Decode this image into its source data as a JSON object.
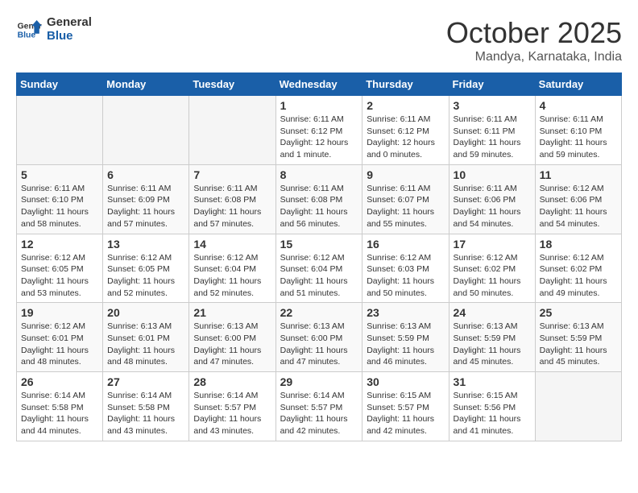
{
  "header": {
    "logo_line1": "General",
    "logo_line2": "Blue",
    "month": "October 2025",
    "location": "Mandya, Karnataka, India"
  },
  "weekdays": [
    "Sunday",
    "Monday",
    "Tuesday",
    "Wednesday",
    "Thursday",
    "Friday",
    "Saturday"
  ],
  "weeks": [
    [
      {
        "day": "",
        "info": ""
      },
      {
        "day": "",
        "info": ""
      },
      {
        "day": "",
        "info": ""
      },
      {
        "day": "1",
        "info": "Sunrise: 6:11 AM\nSunset: 6:12 PM\nDaylight: 12 hours\nand 1 minute."
      },
      {
        "day": "2",
        "info": "Sunrise: 6:11 AM\nSunset: 6:12 PM\nDaylight: 12 hours\nand 0 minutes."
      },
      {
        "day": "3",
        "info": "Sunrise: 6:11 AM\nSunset: 6:11 PM\nDaylight: 11 hours\nand 59 minutes."
      },
      {
        "day": "4",
        "info": "Sunrise: 6:11 AM\nSunset: 6:10 PM\nDaylight: 11 hours\nand 59 minutes."
      }
    ],
    [
      {
        "day": "5",
        "info": "Sunrise: 6:11 AM\nSunset: 6:10 PM\nDaylight: 11 hours\nand 58 minutes."
      },
      {
        "day": "6",
        "info": "Sunrise: 6:11 AM\nSunset: 6:09 PM\nDaylight: 11 hours\nand 57 minutes."
      },
      {
        "day": "7",
        "info": "Sunrise: 6:11 AM\nSunset: 6:08 PM\nDaylight: 11 hours\nand 57 minutes."
      },
      {
        "day": "8",
        "info": "Sunrise: 6:11 AM\nSunset: 6:08 PM\nDaylight: 11 hours\nand 56 minutes."
      },
      {
        "day": "9",
        "info": "Sunrise: 6:11 AM\nSunset: 6:07 PM\nDaylight: 11 hours\nand 55 minutes."
      },
      {
        "day": "10",
        "info": "Sunrise: 6:11 AM\nSunset: 6:06 PM\nDaylight: 11 hours\nand 54 minutes."
      },
      {
        "day": "11",
        "info": "Sunrise: 6:12 AM\nSunset: 6:06 PM\nDaylight: 11 hours\nand 54 minutes."
      }
    ],
    [
      {
        "day": "12",
        "info": "Sunrise: 6:12 AM\nSunset: 6:05 PM\nDaylight: 11 hours\nand 53 minutes."
      },
      {
        "day": "13",
        "info": "Sunrise: 6:12 AM\nSunset: 6:05 PM\nDaylight: 11 hours\nand 52 minutes."
      },
      {
        "day": "14",
        "info": "Sunrise: 6:12 AM\nSunset: 6:04 PM\nDaylight: 11 hours\nand 52 minutes."
      },
      {
        "day": "15",
        "info": "Sunrise: 6:12 AM\nSunset: 6:04 PM\nDaylight: 11 hours\nand 51 minutes."
      },
      {
        "day": "16",
        "info": "Sunrise: 6:12 AM\nSunset: 6:03 PM\nDaylight: 11 hours\nand 50 minutes."
      },
      {
        "day": "17",
        "info": "Sunrise: 6:12 AM\nSunset: 6:02 PM\nDaylight: 11 hours\nand 50 minutes."
      },
      {
        "day": "18",
        "info": "Sunrise: 6:12 AM\nSunset: 6:02 PM\nDaylight: 11 hours\nand 49 minutes."
      }
    ],
    [
      {
        "day": "19",
        "info": "Sunrise: 6:12 AM\nSunset: 6:01 PM\nDaylight: 11 hours\nand 48 minutes."
      },
      {
        "day": "20",
        "info": "Sunrise: 6:13 AM\nSunset: 6:01 PM\nDaylight: 11 hours\nand 48 minutes."
      },
      {
        "day": "21",
        "info": "Sunrise: 6:13 AM\nSunset: 6:00 PM\nDaylight: 11 hours\nand 47 minutes."
      },
      {
        "day": "22",
        "info": "Sunrise: 6:13 AM\nSunset: 6:00 PM\nDaylight: 11 hours\nand 47 minutes."
      },
      {
        "day": "23",
        "info": "Sunrise: 6:13 AM\nSunset: 5:59 PM\nDaylight: 11 hours\nand 46 minutes."
      },
      {
        "day": "24",
        "info": "Sunrise: 6:13 AM\nSunset: 5:59 PM\nDaylight: 11 hours\nand 45 minutes."
      },
      {
        "day": "25",
        "info": "Sunrise: 6:13 AM\nSunset: 5:59 PM\nDaylight: 11 hours\nand 45 minutes."
      }
    ],
    [
      {
        "day": "26",
        "info": "Sunrise: 6:14 AM\nSunset: 5:58 PM\nDaylight: 11 hours\nand 44 minutes."
      },
      {
        "day": "27",
        "info": "Sunrise: 6:14 AM\nSunset: 5:58 PM\nDaylight: 11 hours\nand 43 minutes."
      },
      {
        "day": "28",
        "info": "Sunrise: 6:14 AM\nSunset: 5:57 PM\nDaylight: 11 hours\nand 43 minutes."
      },
      {
        "day": "29",
        "info": "Sunrise: 6:14 AM\nSunset: 5:57 PM\nDaylight: 11 hours\nand 42 minutes."
      },
      {
        "day": "30",
        "info": "Sunrise: 6:15 AM\nSunset: 5:57 PM\nDaylight: 11 hours\nand 42 minutes."
      },
      {
        "day": "31",
        "info": "Sunrise: 6:15 AM\nSunset: 5:56 PM\nDaylight: 11 hours\nand 41 minutes."
      },
      {
        "day": "",
        "info": ""
      }
    ]
  ]
}
